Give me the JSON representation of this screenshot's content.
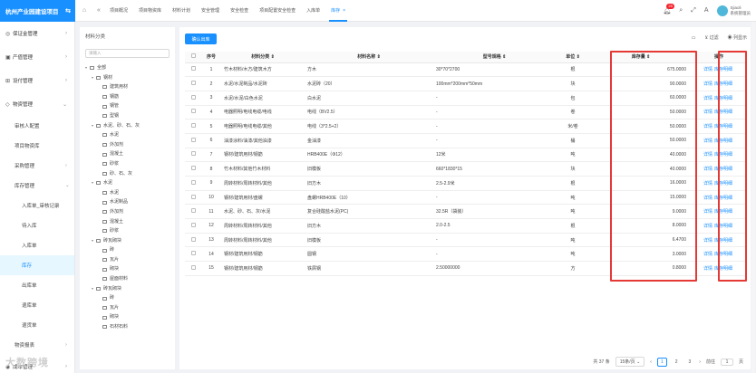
{
  "app": {
    "title": "杭州产业园建设项目",
    "user_name": "Sjiaoli",
    "user_role": "系统管理员",
    "notifications": "25"
  },
  "tabs": [
    "项目概况",
    "项目物资库",
    "材料计划",
    "安全管理",
    "安全检查",
    "项目配置安全检查",
    "入库单",
    "库存"
  ],
  "sidebar": {
    "items": [
      {
        "icon": "shield-icon",
        "label": "保证金管理"
      },
      {
        "icon": "building-icon",
        "label": "产值管理"
      },
      {
        "icon": "cart-icon",
        "label": "设付管理"
      },
      {
        "icon": "box-icon",
        "label": "物资管理"
      }
    ],
    "sub_items": [
      "审核人配置",
      "项目物资库",
      "采购管理",
      "库存管理"
    ],
    "subsub_items": [
      "入库单_审核记录",
      "待入库",
      "入库单",
      "库存",
      "出库单",
      "退库单",
      "退货单"
    ],
    "bottom_items": [
      "物资报表",
      "成本管理"
    ],
    "active": "库存"
  },
  "category": {
    "title": "材料分类",
    "search_placeholder": "请输入",
    "tree": [
      {
        "level": 0,
        "label": "全部",
        "caret": "▾"
      },
      {
        "level": 1,
        "label": "钢材",
        "caret": "▾"
      },
      {
        "level": 2,
        "label": "建筑用材",
        "caret": ""
      },
      {
        "level": 2,
        "label": "钢筋",
        "caret": ""
      },
      {
        "level": 2,
        "label": "钢管",
        "caret": ""
      },
      {
        "level": 2,
        "label": "型钢",
        "caret": ""
      },
      {
        "level": 1,
        "label": "水泥、砂、石、灰",
        "caret": "▾"
      },
      {
        "level": 2,
        "label": "水泥",
        "caret": ""
      },
      {
        "level": 2,
        "label": "外加剂",
        "caret": ""
      },
      {
        "level": 2,
        "label": "混凝土",
        "caret": ""
      },
      {
        "level": 2,
        "label": "砂浆",
        "caret": ""
      },
      {
        "level": 2,
        "label": "砂、石、灰",
        "caret": ""
      },
      {
        "level": 1,
        "label": "水泥",
        "caret": "▾"
      },
      {
        "level": 2,
        "label": "水泥",
        "caret": ""
      },
      {
        "level": 2,
        "label": "水泥制品",
        "caret": ""
      },
      {
        "level": 2,
        "label": "外加剂",
        "caret": ""
      },
      {
        "level": 2,
        "label": "混凝土",
        "caret": ""
      },
      {
        "level": 2,
        "label": "砂浆",
        "caret": ""
      },
      {
        "level": 1,
        "label": "砖瓦砌块",
        "caret": "▾"
      },
      {
        "level": 2,
        "label": "砖",
        "caret": ""
      },
      {
        "level": 2,
        "label": "瓦片",
        "caret": ""
      },
      {
        "level": 2,
        "label": "砌块",
        "caret": ""
      },
      {
        "level": 2,
        "label": "屋面材料",
        "caret": ""
      },
      {
        "level": 1,
        "label": "砖瓦砌块",
        "caret": "▾"
      },
      {
        "level": 2,
        "label": "砖",
        "caret": ""
      },
      {
        "level": 2,
        "label": "瓦片",
        "caret": ""
      },
      {
        "level": 2,
        "label": "砌块",
        "caret": ""
      },
      {
        "level": 2,
        "label": "石材石料",
        "caret": ""
      }
    ]
  },
  "toolbar": {
    "confirm_label": "确认出库",
    "filter_label": "过滤",
    "columns_label": "列显示"
  },
  "table": {
    "headers": [
      "序号",
      "材料分类",
      "材料名称",
      "型号规格",
      "单位",
      "库存量",
      "操作"
    ],
    "rows": [
      [
        "1",
        "竹木材料/木方/建筑木方",
        "方木",
        "30*70*2700",
        "根",
        "675.0000"
      ],
      [
        "2",
        "水泥/水泥制品/水泥砖",
        "水泥砖（20）",
        "100mm*200mm*50mm",
        "块",
        "90.0000"
      ],
      [
        "3",
        "水泥/水泥/白色水泥",
        "白水泥",
        "-",
        "包",
        "60.0000"
      ],
      [
        "4",
        "电器照明/电线电缆/电线",
        "电线（BV2.5）",
        "-",
        "卷",
        "50.0000"
      ],
      [
        "5",
        "电器照明/电线电缆/其他",
        "电线（3*2.5+2）",
        "-",
        "米/卷",
        "50.0000"
      ],
      [
        "6",
        "油漆涂料/油漆/其他油漆",
        "金油漆",
        "-",
        "桶",
        "50.0000"
      ],
      [
        "7",
        "钢材/建筑用材/钢筋",
        "HRB400E（Φ12）",
        "12米",
        "吨",
        "40.0000"
      ],
      [
        "8",
        "竹木材料/其他竹木材料",
        "旧模板",
        "660*1830*15",
        "块",
        "40.0000"
      ],
      [
        "9",
        "周转材料/周转材料/其他",
        "旧方木",
        "2.5-2.9米",
        "根",
        "16.0000"
      ],
      [
        "10",
        "钢材/建筑用材/盘螺",
        "盘螺HRB400E（10）",
        "-",
        "吨",
        "15.0000"
      ],
      [
        "11",
        "水泥、砂、石、灰/水泥",
        "复合硅酸盐水泥(PC)",
        "32.5R（袋装）",
        "吨",
        "9.0000"
      ],
      [
        "12",
        "周转材料/周转材料/其他",
        "旧方木",
        "2.0-2.5",
        "根",
        "8.0000"
      ],
      [
        "13",
        "周转材料/周转材料/其他",
        "旧模板",
        "-",
        "吨",
        "6.4700"
      ],
      [
        "14",
        "钢材/建筑用材/钢筋",
        "圆钢",
        "-",
        "吨",
        "3.0000"
      ],
      [
        "15",
        "钢材/建筑用材/钢筋",
        "铁屑钢",
        "2.50000000",
        "方",
        "0.8000"
      ]
    ],
    "op_detail": "详情",
    "op_record": "库存明细"
  },
  "pager": {
    "total": "共 37 条",
    "page_size": "15条/页",
    "pages": [
      "1",
      "2",
      "3"
    ],
    "current": "1",
    "goto_label": "前往",
    "goto_value": "1",
    "page_unit": "页"
  },
  "watermark": "大数跨境",
  "colors": {
    "accent": "#1890ff",
    "highlight": "#e53935"
  }
}
